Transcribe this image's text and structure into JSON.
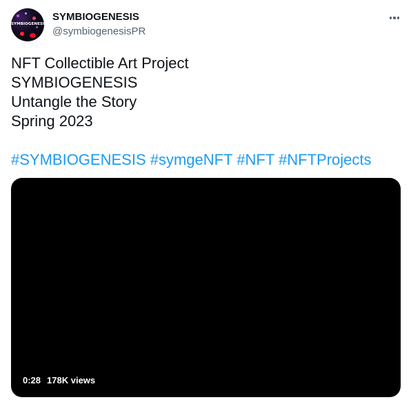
{
  "account": {
    "display_name": "SYMBIOGENESIS",
    "handle": "@symbiogenesisPR",
    "avatar_text": "SYMBIOGENESIS"
  },
  "tweet": {
    "lines": [
      "NFT Collectible Art Project",
      "SYMBIOGENESIS",
      "Untangle the Story",
      "Spring 2023"
    ],
    "hashtags": [
      "#SYMBIOGENESIS",
      "#symgeNFT",
      "#NFT",
      "#NFTProjects"
    ]
  },
  "media": {
    "duration": "0:28",
    "views": "178K views"
  },
  "icons": {
    "more": "more-horizontal-icon"
  },
  "colors": {
    "text_primary": "#0f1419",
    "text_secondary": "#536471",
    "link": "#1d9bf0",
    "media_bg": "#000000"
  }
}
